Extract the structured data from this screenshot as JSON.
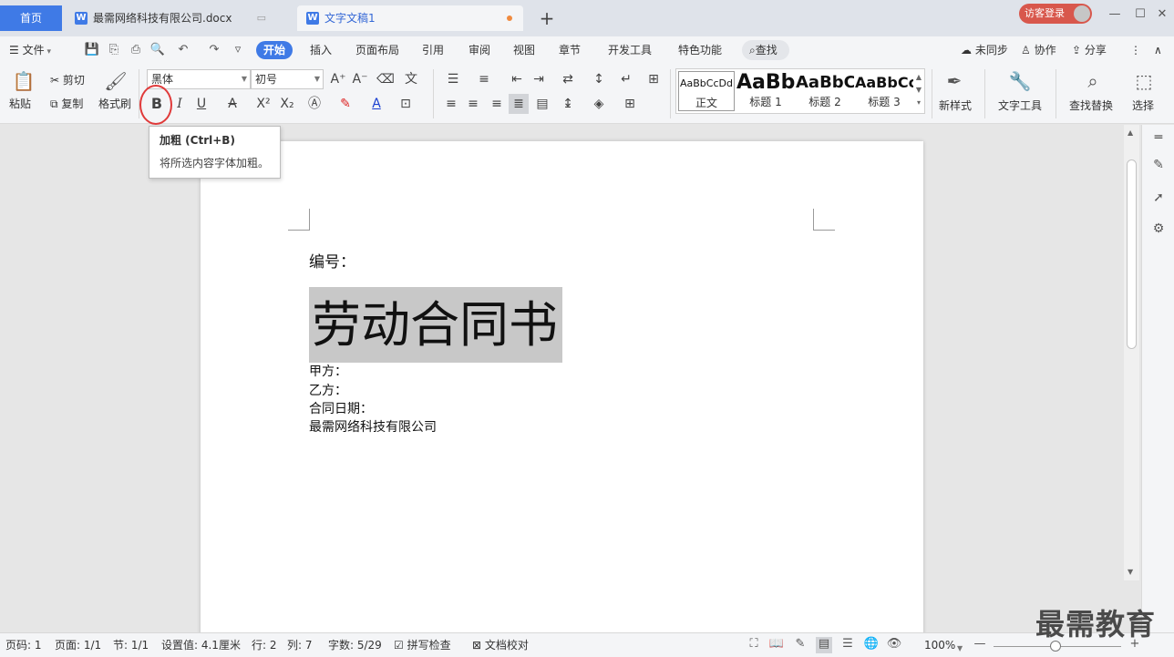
{
  "tabs": {
    "home": "首页",
    "doc1": "最需网络科技有限公司.docx",
    "doc2": "文字文稿1",
    "new_tab": "+",
    "doc1_extra": "▭"
  },
  "titlebar": {
    "login": "访客登录",
    "min": "—",
    "max": "☐",
    "close": "✕"
  },
  "menu": {
    "file": "文件",
    "items": [
      "开始",
      "插入",
      "页面布局",
      "引用",
      "审阅",
      "视图",
      "章节",
      "开发工具",
      "特色功能"
    ],
    "search": "查找",
    "sync": "未同步",
    "collab": "协作",
    "share": "分享"
  },
  "ribbon": {
    "paste": "粘贴",
    "cut": "剪切",
    "copy": "复制",
    "format_painter": "格式刷",
    "font_name": "黑体",
    "font_size": "初号",
    "bold": "B",
    "italic": "I",
    "underline": "U",
    "strike": "A",
    "superscript": "X²",
    "subscript": "X₂",
    "font_color": "A",
    "styles": [
      {
        "preview": "AaBbCcDd",
        "name": "正文"
      },
      {
        "preview": "AaBb",
        "name": "标题 1"
      },
      {
        "preview": "AaBbC",
        "name": "标题 2"
      },
      {
        "preview": "AaBbCc",
        "name": "标题 3"
      }
    ],
    "new_style": "新样式",
    "text_tools": "文字工具",
    "find_replace": "查找替换",
    "select": "选择"
  },
  "tooltip": {
    "title": "加粗 (Ctrl+B)",
    "desc": "将所选内容字体加粗。"
  },
  "document": {
    "number_label": "编号：",
    "title": "劳动合同书",
    "lines": [
      "甲方：",
      "乙方：",
      "合同日期：",
      "最需网络科技有限公司"
    ]
  },
  "status": {
    "page_num": "页码: 1",
    "pages": "页面: 1/1",
    "section": "节: 1/1",
    "setting": "设置值: 4.1厘米",
    "row": "行: 2",
    "col": "列: 7",
    "words": "字数: 5/29",
    "spell": "拼写检查",
    "proof": "文档校对",
    "zoom": "100%"
  },
  "watermark": "最需教育",
  "colors": {
    "accent": "#3f7ae6",
    "login": "#d8574c",
    "highlight_circle": "#e03a3a",
    "selection": "#c8c8c8"
  }
}
